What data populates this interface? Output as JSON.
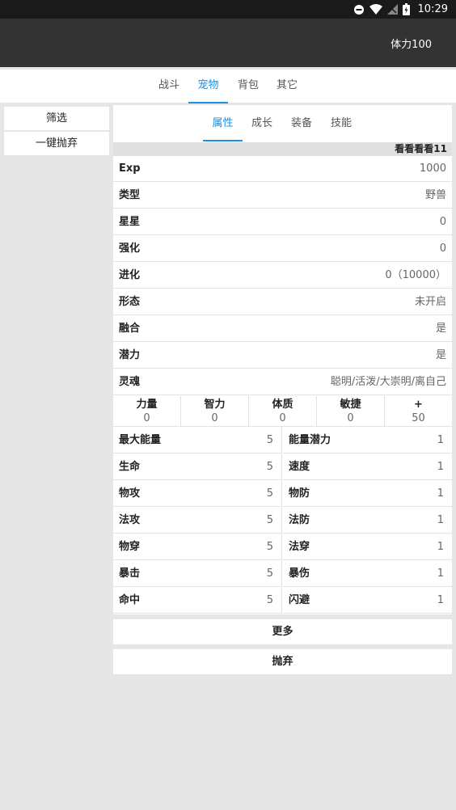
{
  "status_bar": {
    "time": "10:29",
    "icons": [
      "dnd-icon",
      "wifi-icon",
      "signal-icon",
      "battery-icon"
    ]
  },
  "header": {
    "stamina": "体力100"
  },
  "main_tabs": [
    {
      "label": "战斗",
      "active": false
    },
    {
      "label": "宠物",
      "active": true
    },
    {
      "label": "背包",
      "active": false
    },
    {
      "label": "其它",
      "active": false
    }
  ],
  "sidebar": {
    "filter_label": "筛选",
    "discard_all_label": "一键抛弃"
  },
  "sub_tabs": [
    {
      "label": "属性",
      "active": true
    },
    {
      "label": "成长",
      "active": false
    },
    {
      "label": "装备",
      "active": false
    },
    {
      "label": "技能",
      "active": false
    }
  ],
  "pet_name": "看看看看11",
  "attributes": [
    {
      "key": "Exp",
      "value": "1000"
    },
    {
      "key": "类型",
      "value": "野兽"
    },
    {
      "key": "星星",
      "value": "0"
    },
    {
      "key": "强化",
      "value": "0"
    },
    {
      "key": "进化",
      "value": "0（10000）"
    },
    {
      "key": "形态",
      "value": "未开启"
    },
    {
      "key": "融合",
      "value": "是"
    },
    {
      "key": "潜力",
      "value": "是"
    },
    {
      "key": "灵魂",
      "value": "聪明/活泼/大崇明/离自己"
    }
  ],
  "base_stats": [
    {
      "label": "力量",
      "value": "0"
    },
    {
      "label": "智力",
      "value": "0"
    },
    {
      "label": "体质",
      "value": "0"
    },
    {
      "label": "敏捷",
      "value": "0"
    },
    {
      "label": "+",
      "value": "50"
    }
  ],
  "combat_stats": [
    {
      "left_key": "最大能量",
      "left_value": "5",
      "right_key": "能量潜力",
      "right_value": "1"
    },
    {
      "left_key": "生命",
      "left_value": "5",
      "right_key": "速度",
      "right_value": "1"
    },
    {
      "left_key": "物攻",
      "left_value": "5",
      "right_key": "物防",
      "right_value": "1"
    },
    {
      "left_key": "法攻",
      "left_value": "5",
      "right_key": "法防",
      "right_value": "1"
    },
    {
      "left_key": "物穿",
      "left_value": "5",
      "right_key": "法穿",
      "right_value": "1"
    },
    {
      "left_key": "暴击",
      "left_value": "5",
      "right_key": "暴伤",
      "right_value": "1"
    },
    {
      "left_key": "命中",
      "left_value": "5",
      "right_key": "闪避",
      "right_value": "1"
    }
  ],
  "actions": {
    "more_label": "更多",
    "discard_label": "抛弃"
  },
  "colors": {
    "accent": "#1a8fe3",
    "appbar": "#333333",
    "background": "#e6e6e6"
  }
}
